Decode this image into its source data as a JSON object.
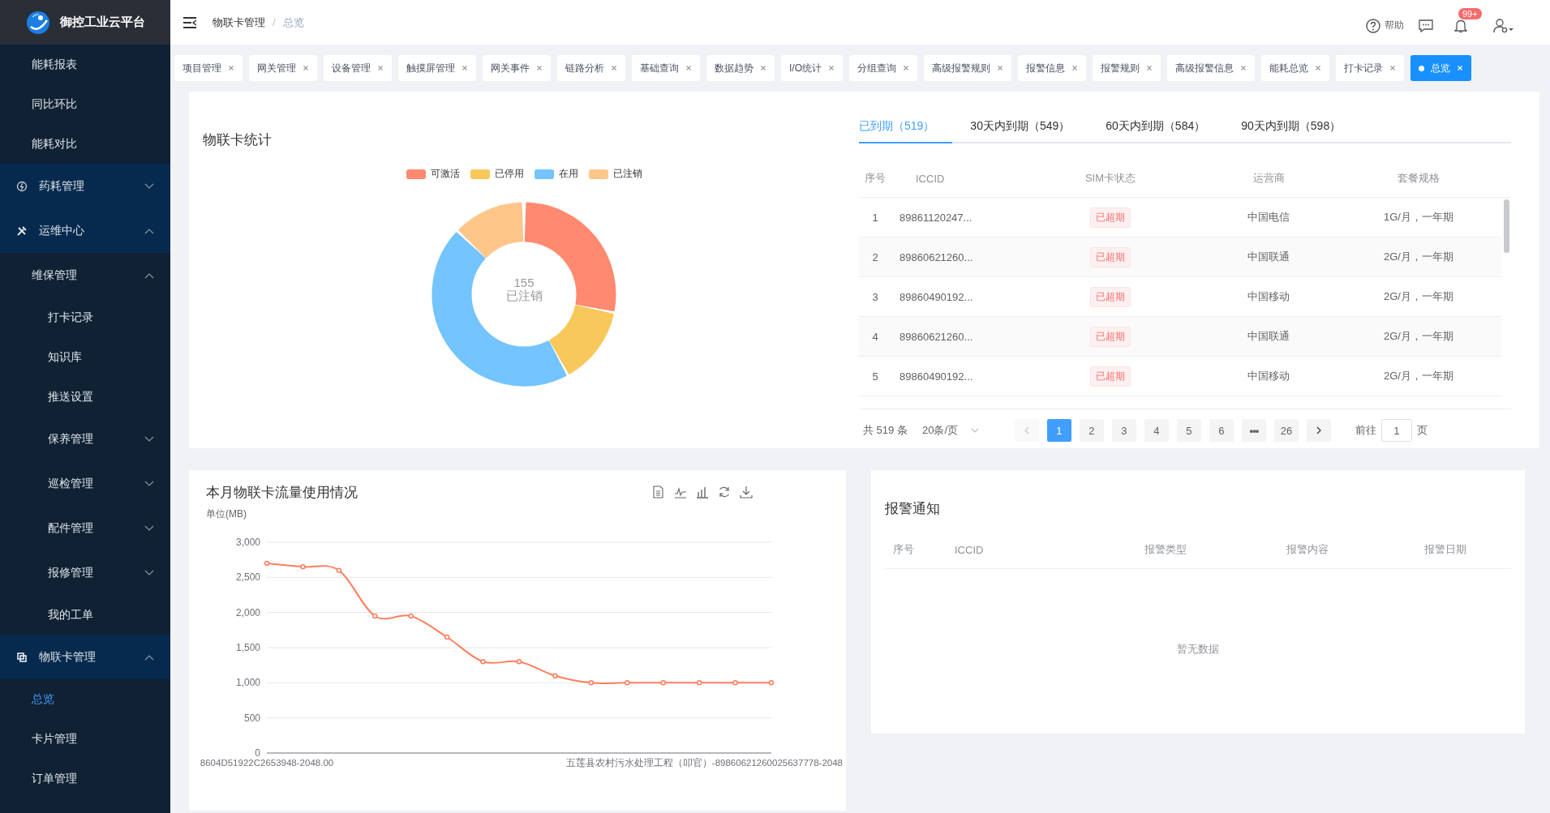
{
  "brand": {
    "title": "御控工业云平台"
  },
  "breadcrumb": {
    "items": [
      "物联卡管理",
      "总览"
    ],
    "separator": "/"
  },
  "header_actions": {
    "help": "帮助",
    "badge": "99+"
  },
  "sidebar": {
    "upper_items": [
      {
        "label": "能耗报表",
        "selected": false
      },
      {
        "label": "同比环比",
        "selected": false
      },
      {
        "label": "能耗对比",
        "selected": false
      }
    ],
    "items": [
      {
        "label": "药耗管理",
        "expanded": false,
        "selected": false
      },
      {
        "label": "运维中心",
        "expanded": true,
        "selected": false,
        "children": [
          {
            "label": "维保管理",
            "expanded": true,
            "selected": false,
            "children": [
              {
                "label": "打卡记录",
                "selected": false
              },
              {
                "label": "知识库",
                "selected": false
              },
              {
                "label": "推送设置",
                "selected": false
              },
              {
                "label": "保养管理",
                "expanded": false,
                "selected": false
              },
              {
                "label": "巡检管理",
                "expanded": false,
                "selected": false
              },
              {
                "label": "配件管理",
                "expanded": false,
                "selected": false
              },
              {
                "label": "报修管理",
                "expanded": false,
                "selected": false
              },
              {
                "label": "我的工单",
                "selected": false
              }
            ]
          }
        ]
      },
      {
        "label": "物联卡管理",
        "expanded": true,
        "selected": false,
        "children": [
          {
            "label": "总览",
            "selected": true
          },
          {
            "label": "卡片管理",
            "selected": false
          },
          {
            "label": "订单管理",
            "selected": false
          }
        ]
      }
    ]
  },
  "tabs": [
    {
      "label": "项目管理",
      "selected": false
    },
    {
      "label": "网关管理",
      "selected": false
    },
    {
      "label": "设备管理",
      "selected": false
    },
    {
      "label": "触摸屏管理",
      "selected": false
    },
    {
      "label": "网关事件",
      "selected": false
    },
    {
      "label": "链路分析",
      "selected": false
    },
    {
      "label": "基础查询",
      "selected": false
    },
    {
      "label": "数据趋势",
      "selected": false
    },
    {
      "label": "I/O统计",
      "selected": false
    },
    {
      "label": "分组查询",
      "selected": false
    },
    {
      "label": "高级报警规则",
      "selected": false
    },
    {
      "label": "报警信息",
      "selected": false
    },
    {
      "label": "报警规则",
      "selected": false
    },
    {
      "label": "高级报警信息",
      "selected": false
    },
    {
      "label": "能耗总览",
      "selected": false
    },
    {
      "label": "打卡记录",
      "selected": false
    },
    {
      "label": "总览",
      "selected": true
    }
  ],
  "card_stats": {
    "title": "物联卡统计",
    "legend": [
      {
        "label": "可激活",
        "color": "#ff8a70"
      },
      {
        "label": "已停用",
        "color": "#f9c85b"
      },
      {
        "label": "在用",
        "color": "#73c4ff"
      },
      {
        "label": "已注销",
        "color": "#ffc68a"
      }
    ],
    "center_value": "155",
    "center_label": "已注销"
  },
  "expiry": {
    "tabs": [
      {
        "label": "已到期（519）",
        "selected": true
      },
      {
        "label": "30天内到期（549）",
        "selected": false
      },
      {
        "label": "60天内到期（584）",
        "selected": false
      },
      {
        "label": "90天内到期（598）",
        "selected": false
      }
    ],
    "columns": [
      "序号",
      "ICCID",
      "SIM卡状态",
      "运营商",
      "套餐规格"
    ],
    "rows": [
      [
        "1",
        "89861120247...",
        "已超期",
        "中国电信",
        "1G/月，一年期"
      ],
      [
        "2",
        "89860621260...",
        "已超期",
        "中国联通",
        "2G/月，一年期"
      ],
      [
        "3",
        "89860490192...",
        "已超期",
        "中国移动",
        "2G/月，一年期"
      ],
      [
        "4",
        "89860621260...",
        "已超期",
        "中国联通",
        "2G/月，一年期"
      ],
      [
        "5",
        "89860490192...",
        "已超期",
        "中国移动",
        "2G/月，一年期"
      ]
    ],
    "pagination": {
      "total": "共 519 条",
      "page_size": "20条/页",
      "prev_disabled": true,
      "next_disabled": false,
      "pages": [
        {
          "label": "1",
          "kind": "page",
          "selected": true
        },
        {
          "label": "2",
          "kind": "page",
          "selected": false
        },
        {
          "label": "3",
          "kind": "page",
          "selected": false
        },
        {
          "label": "4",
          "kind": "page",
          "selected": false
        },
        {
          "label": "5",
          "kind": "page",
          "selected": false
        },
        {
          "label": "6",
          "kind": "page",
          "selected": false
        },
        {
          "label": "•••",
          "kind": "more",
          "selected": false
        },
        {
          "label": "26",
          "kind": "page",
          "selected": false
        }
      ],
      "goto_label": "前往",
      "goto_value": "1",
      "goto_suffix": "页"
    }
  },
  "traffic": {
    "chart_data": {
      "type": "line",
      "title": "本月物联卡流量使用情况",
      "ylabel": "单位(MB)",
      "categories": [
        "8604D51922C2653948-2048.00",
        null,
        null,
        null,
        null,
        null,
        null,
        null,
        null,
        null,
        null,
        null,
        "五莲县农村污水处理工程（叩官）-89860621260025637778-2048",
        null,
        null
      ],
      "grid": true,
      "series": [
        {
          "color": "#ff7f5e",
          "marker": true,
          "values": [
            2700,
            2650,
            2600,
            1950,
            1950,
            1650,
            1300,
            1300,
            1100,
            1000,
            1000,
            1000,
            1000,
            1000,
            1000
          ]
        }
      ],
      "ylim": [
        0,
        3000
      ],
      "yticks": [
        {
          "value": 0,
          "label": "0"
        },
        {
          "value": 500,
          "label": "500"
        },
        {
          "value": 1000,
          "label": "1,000"
        },
        {
          "value": 1500,
          "label": "1,500"
        },
        {
          "value": 2000,
          "label": "2,000"
        },
        {
          "value": 2500,
          "label": "2,500"
        },
        {
          "value": 3000,
          "label": "3,000"
        }
      ]
    }
  },
  "alarms": {
    "title": "报警通知",
    "columns": [
      "序号",
      "ICCID",
      "报警类型",
      "报警内容",
      "报警日期"
    ],
    "empty_text": "暂无数据"
  }
}
